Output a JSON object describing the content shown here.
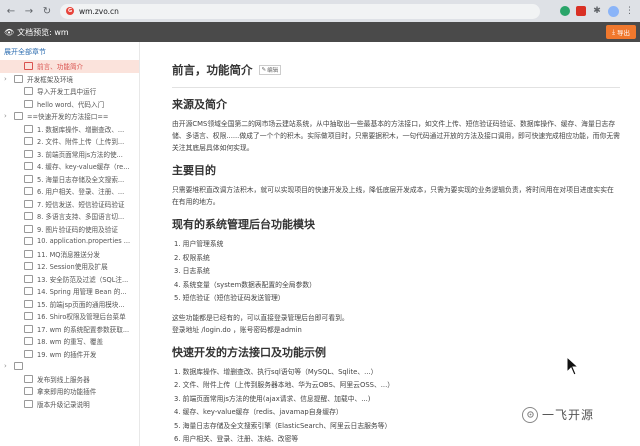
{
  "browser": {
    "url": "wm.zvo.cn",
    "favicon_letter": "G"
  },
  "app": {
    "title": "文档预览: wm",
    "export_label": "导出"
  },
  "sidebar": {
    "expand_label": "展开全部章节",
    "items": [
      {
        "label": "前言、功能简介",
        "level": 1,
        "arrow": "",
        "active": true
      },
      {
        "label": "开发框架及环境",
        "level": 0,
        "arrow": "›",
        "active": false
      },
      {
        "label": "导入开发工具中运行",
        "level": 1,
        "arrow": "",
        "active": false
      },
      {
        "label": "hello word、代码入门",
        "level": 1,
        "arrow": "",
        "active": false
      },
      {
        "label": "==快速开发的方法接口==",
        "level": 0,
        "arrow": "›",
        "active": false
      },
      {
        "label": "1. 数据库操作、增删查改、...",
        "level": 1,
        "arrow": "",
        "active": false
      },
      {
        "label": "2. 文件、附件上传（上传到...",
        "level": 1,
        "arrow": "",
        "active": false
      },
      {
        "label": "3. 前端页面常用js方法的使...",
        "level": 1,
        "arrow": "",
        "active": false
      },
      {
        "label": "4. 缓存、key-value缓存（re...",
        "level": 1,
        "arrow": "",
        "active": false
      },
      {
        "label": "5. 海量日志存储及全文搜索...",
        "level": 1,
        "arrow": "",
        "active": false
      },
      {
        "label": "6. 用户相关、登录、注册、...",
        "level": 1,
        "arrow": "",
        "active": false
      },
      {
        "label": "7. 短信发送、短信验证码验证",
        "level": 1,
        "arrow": "",
        "active": false
      },
      {
        "label": "8. 多语言支持、多国语言切...",
        "level": 1,
        "arrow": "",
        "active": false
      },
      {
        "label": "9. 图片验证码的使用及验证",
        "level": 1,
        "arrow": "",
        "active": false
      },
      {
        "label": "10. application.properties ...",
        "level": 1,
        "arrow": "",
        "active": false
      },
      {
        "label": "11. MQ消息推送分发",
        "level": 1,
        "arrow": "",
        "active": false
      },
      {
        "label": "12. Session使用及扩展",
        "level": 1,
        "arrow": "",
        "active": false
      },
      {
        "label": "13. 安全防范及过滤（SQL注...",
        "level": 1,
        "arrow": "",
        "active": false
      },
      {
        "label": "14. Spring 用管理 Bean 的...",
        "level": 1,
        "arrow": "",
        "active": false
      },
      {
        "label": "15. 前端jsp页面的通用模块...",
        "level": 1,
        "arrow": "",
        "active": false
      },
      {
        "label": "16. Shiro权限及管理后台菜单",
        "level": 1,
        "arrow": "",
        "active": false
      },
      {
        "label": "17. wm 的系统配置参数获取...",
        "level": 1,
        "arrow": "",
        "active": false
      },
      {
        "label": "18. wm 的重写、覆盖",
        "level": 1,
        "arrow": "",
        "active": false
      },
      {
        "label": "19. wm 的插件开发",
        "level": 1,
        "arrow": "",
        "active": false
      },
      {
        "label": "",
        "level": 0,
        "arrow": "›",
        "active": false
      },
      {
        "label": "发布到线上服务器",
        "level": 1,
        "arrow": "",
        "active": false
      },
      {
        "label": "拿来即用的功能插件",
        "level": 1,
        "arrow": "",
        "active": false
      },
      {
        "label": "版本升级记录说明",
        "level": 1,
        "arrow": "",
        "active": false
      }
    ]
  },
  "content": {
    "title": "前言，功能简介",
    "edit_label": "编辑",
    "sections": {
      "source": {
        "heading": "来源及简介",
        "text": "由开源CMS领域全国第二的网市场云建站系统，从中抽取出一些最基本的方法接口，如文件上传、短信验证码验证、数据库操作、缓存、海量日志存储、多语言、权限......做成了一个个的积木。实际做项目时，只需要据积木，一句代码通过开放的方法及接口调用，即可快速完成相应功能，而你无需关注其底层具体如何实现。"
      },
      "purpose": {
        "heading": "主要目的",
        "text": "只需要堆积直改调方法积木，就可以实现项目的快速开发及上线，降低底层开发成本，只需为要实现的业务逻辑负责，将时间用在对项目进度实实在在有用的地方。"
      },
      "modules": {
        "heading": "现有的系统管理后台功能模块",
        "items": [
          "1. 用户管理系统",
          "2. 权限系统",
          "3. 日志系统",
          "4. 系统变量（system数据表配置的全局参数）",
          "5. 短信验证（短信验证码发送管理）"
        ],
        "note1": "这些功能都是已经有的，可以直接登录管理后台即可看到。",
        "note2": "登录地址 /login.do ，账号密码都是admin"
      },
      "quick": {
        "heading": "快速开发的方法接口及功能示例",
        "items": [
          "1. 数据库操作、增删查改、执行sql语句等（MySQL、Sqlite、...）",
          "2. 文件、附件上传（上传到服务器本地、华为云OBS、阿里云OSS、...）",
          "3. 前端页面常用js方法的使用(ajax请求、信息提醒、加载中、...)",
          "4. 缓存、key-value缓存（redis、javamap自身缓存）",
          "5. 海量日志存储及全文搜索引擎（ElasticSearch、阿里云日志服务等）",
          "6. 用户相关、登录、注册、冻结、改密等"
        ]
      }
    }
  },
  "watermark": {
    "text": "一飞开源"
  },
  "colors": {
    "accent": "#f0782d",
    "active_bg": "#fbe3dc",
    "active_text": "#d9534f",
    "header_bg": "#4a4a4a"
  }
}
